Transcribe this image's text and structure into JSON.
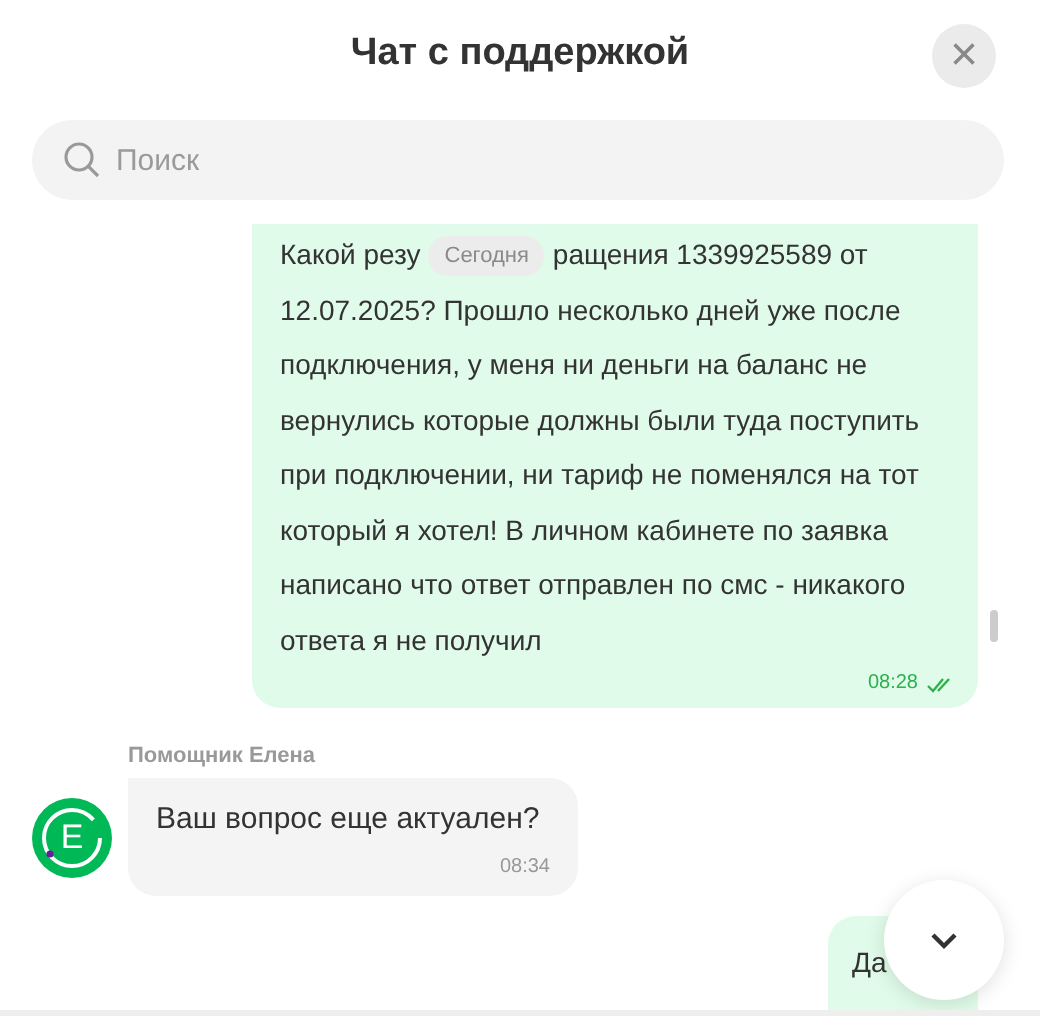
{
  "header": {
    "title": "Чат с поддержкой",
    "close": "×"
  },
  "search": {
    "placeholder": "Поиск"
  },
  "date_chip": "Сегодня",
  "messages": [
    {
      "kind": "outgoing",
      "text_before_chip": "Какой резу",
      "text_after_chip": "ращения 1339925589 от",
      "text": "12.07.2025? Прошло несколько дней уже после подключения, у меня ни деньги на баланс не вернулись которые должны были туда поступить при подключении, ни тариф не поменялся на тот который я хотел! В личном кабинете по заявка написано что ответ отправлен по смс - никакого ответа я не получил",
      "time": "08:28",
      "read": true
    },
    {
      "kind": "incoming",
      "author": "Помощник Елена",
      "avatar": "E",
      "text": "Ваш вопрос еще актуален?",
      "time": "08:34"
    },
    {
      "kind": "outgoing",
      "text": "Да"
    }
  ]
}
